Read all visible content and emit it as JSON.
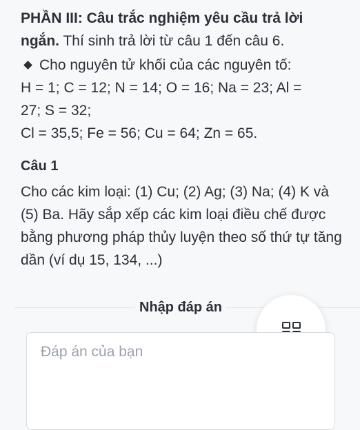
{
  "section": {
    "title_lead": "PHẦN III: Câu trắc nghiệm yêu cầu trả lời ngắn.",
    "title_rest": " Thí sinh trả lời từ câu 1 đến câu 6."
  },
  "atomic_masses": {
    "intro": "Cho nguyên tử khối của các nguyên tố:",
    "line1": "H = 1; C = 12; N = 14; O = 16; Na = 23; Al =",
    "line2": "27; S = 32;",
    "line3": "Cl = 35,5; Fe = 56; Cu = 64; Zn = 65."
  },
  "question": {
    "heading": "Câu 1",
    "text": "Cho các kim loại: (1) Cu; (2) Ag; (3) Na; (4) K và (5) Ba. Hãy sắp xếp các kim loại điều chế được bằng phương pháp thủy luyện theo số thứ tự tăng dần (ví dụ 15, 134, ...)"
  },
  "answer": {
    "label": "Nhập đáp án",
    "placeholder": "Đáp án của bạn",
    "value": ""
  },
  "icons": {
    "bullet": "diamond-bullet-icon",
    "grid": "grid-icon"
  }
}
